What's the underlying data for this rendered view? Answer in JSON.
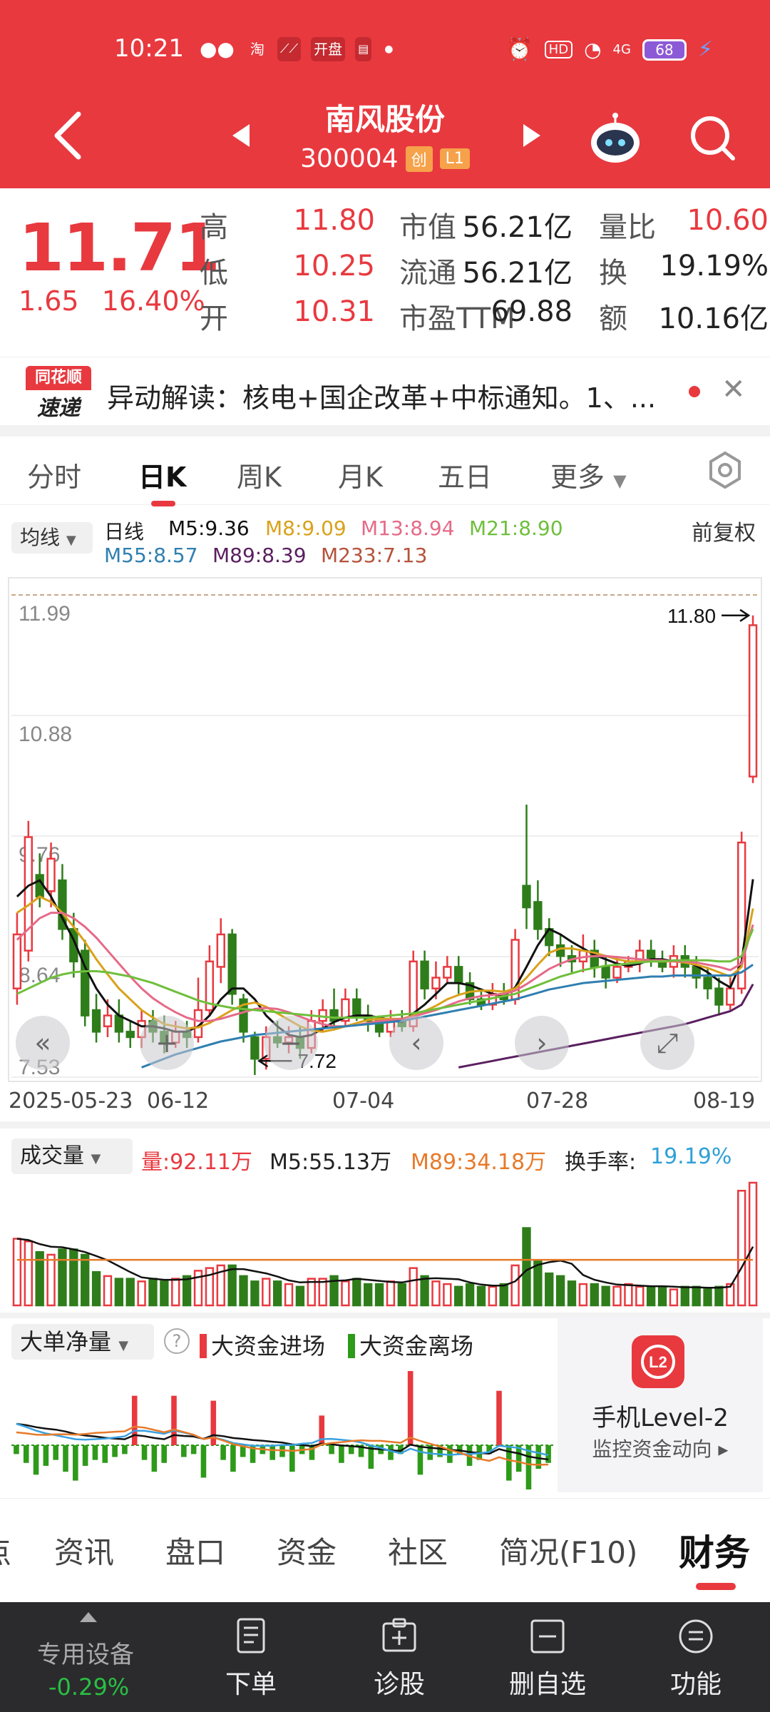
{
  "status": {
    "time": "10:21",
    "apps": [
      "淘",
      "开盘"
    ],
    "network": "HD",
    "signal": "4G",
    "battery": "68"
  },
  "header": {
    "name": "南风股份",
    "code": "300004",
    "tags": [
      "创",
      "L1"
    ]
  },
  "quote": {
    "price": "11.71",
    "change": "1.65",
    "change_pct": "16.40%",
    "rows": [
      {
        "k1": "高",
        "v1": "11.80",
        "k2": "市值",
        "v2": "56.21亿",
        "k3": "量比",
        "v3": "10.60"
      },
      {
        "k1": "低",
        "v1": "10.25",
        "k2": "流通",
        "v2": "56.21亿",
        "k3": "换",
        "v3": "19.19%"
      },
      {
        "k1": "开",
        "v1": "10.31",
        "k2": "市盈TTM",
        "v2": "69.88",
        "k3": "额",
        "v3": "10.16亿"
      }
    ]
  },
  "news": {
    "logo_top": "同花顺",
    "logo_bottom": "速递",
    "text": "异动解读：核电+国企改革+中标通知。1、..."
  },
  "period_tabs": [
    "分时",
    "日K",
    "周K",
    "月K",
    "五日",
    "更多"
  ],
  "ma_legend": {
    "chip": "均线",
    "type": "日线",
    "items": [
      {
        "label": "M5:9.36",
        "color": "#111111"
      },
      {
        "label": "M8:9.09",
        "color": "#d9a21b"
      },
      {
        "label": "M13:8.94",
        "color": "#e56a88"
      },
      {
        "label": "M21:8.90",
        "color": "#6fbf3c"
      },
      {
        "label": "M55:8.57",
        "color": "#2f7fb0"
      },
      {
        "label": "M89:8.39",
        "color": "#5a1f5f"
      },
      {
        "label": "M233:7.13",
        "color": "#b5523a"
      }
    ],
    "adjust": "前复权"
  },
  "chart_data": [
    {
      "type": "candlestick",
      "y_labels": [
        "11.99",
        "10.88",
        "9.76",
        "8.64",
        "7.53"
      ],
      "ylim": [
        7.53,
        11.99
      ],
      "high_mark": "11.80",
      "low_mark": "7.72",
      "x_labels": [
        "2025-05-23",
        "06-12",
        "07-04",
        "07-28",
        "08-19"
      ],
      "candles": [
        [
          8.35,
          8.85,
          8.2,
          9.05
        ],
        [
          8.7,
          9.75,
          8.6,
          9.9
        ],
        [
          9.4,
          9.2,
          9.1,
          9.6
        ],
        [
          9.25,
          9.55,
          9.1,
          9.7
        ],
        [
          9.35,
          8.9,
          8.8,
          9.5
        ],
        [
          8.9,
          8.6,
          8.45,
          9.05
        ],
        [
          8.7,
          8.1,
          8.0,
          8.8
        ],
        [
          8.15,
          7.95,
          7.85,
          8.3
        ],
        [
          8.0,
          8.1,
          7.9,
          8.25
        ],
        [
          8.1,
          7.95,
          7.85,
          8.25
        ],
        [
          7.95,
          7.9,
          7.8,
          8.05
        ],
        [
          7.9,
          8.05,
          7.8,
          8.15
        ],
        [
          8.05,
          7.95,
          7.85,
          8.15
        ],
        [
          7.95,
          7.85,
          7.75,
          8.1
        ],
        [
          7.85,
          7.95,
          7.8,
          8.05
        ],
        [
          7.95,
          7.9,
          7.8,
          8.05
        ],
        [
          7.9,
          8.15,
          7.85,
          8.45
        ],
        [
          8.15,
          8.6,
          8.1,
          8.75
        ],
        [
          8.55,
          8.85,
          8.4,
          9.0
        ],
        [
          8.85,
          8.3,
          8.2,
          8.9
        ],
        [
          8.25,
          7.95,
          7.85,
          8.3
        ],
        [
          7.9,
          7.7,
          7.55,
          7.95
        ],
        [
          7.7,
          7.9,
          7.6,
          8.0
        ],
        [
          7.9,
          7.85,
          7.8,
          8.05
        ],
        [
          7.85,
          7.9,
          7.75,
          8.0
        ],
        [
          7.9,
          7.8,
          7.7,
          8.0
        ],
        [
          7.8,
          8.05,
          7.75,
          8.15
        ],
        [
          8.05,
          8.15,
          7.95,
          8.25
        ],
        [
          8.15,
          8.05,
          8.0,
          8.35
        ],
        [
          8.05,
          8.25,
          8.0,
          8.35
        ],
        [
          8.25,
          8.1,
          8.05,
          8.35
        ],
        [
          8.1,
          8.05,
          7.95,
          8.2
        ],
        [
          8.05,
          7.95,
          7.9,
          8.1
        ],
        [
          7.95,
          8.05,
          7.9,
          8.15
        ],
        [
          8.05,
          8.0,
          7.95,
          8.15
        ],
        [
          8.0,
          8.6,
          7.95,
          8.7
        ],
        [
          8.6,
          8.35,
          8.25,
          8.7
        ],
        [
          8.35,
          8.45,
          8.25,
          8.6
        ],
        [
          8.45,
          8.55,
          8.4,
          8.65
        ],
        [
          8.55,
          8.4,
          8.3,
          8.65
        ],
        [
          8.4,
          8.25,
          8.2,
          8.5
        ],
        [
          8.25,
          8.2,
          8.15,
          8.35
        ],
        [
          8.2,
          8.3,
          8.15,
          8.4
        ],
        [
          8.3,
          8.25,
          8.2,
          8.4
        ],
        [
          8.25,
          8.8,
          8.2,
          8.9
        ],
        [
          9.3,
          9.1,
          8.9,
          10.05
        ],
        [
          9.15,
          8.9,
          8.8,
          9.35
        ],
        [
          8.9,
          8.75,
          8.65,
          9.0
        ],
        [
          8.75,
          8.65,
          8.55,
          8.85
        ],
        [
          8.65,
          8.6,
          8.5,
          8.75
        ],
        [
          8.6,
          8.7,
          8.5,
          8.85
        ],
        [
          8.7,
          8.55,
          8.45,
          8.8
        ],
        [
          8.55,
          8.45,
          8.35,
          8.65
        ],
        [
          8.45,
          8.55,
          8.4,
          8.65
        ],
        [
          8.55,
          8.6,
          8.5,
          8.65
        ],
        [
          8.6,
          8.7,
          8.5,
          8.8
        ],
        [
          8.7,
          8.6,
          8.55,
          8.8
        ],
        [
          8.6,
          8.55,
          8.5,
          8.7
        ],
        [
          8.55,
          8.65,
          8.45,
          8.75
        ],
        [
          8.65,
          8.55,
          8.45,
          8.75
        ],
        [
          8.55,
          8.45,
          8.35,
          8.65
        ],
        [
          8.45,
          8.35,
          8.25,
          8.55
        ],
        [
          8.35,
          8.2,
          8.1,
          8.45
        ],
        [
          8.2,
          8.35,
          8.15,
          8.45
        ],
        [
          8.35,
          9.7,
          8.3,
          9.8
        ],
        [
          10.31,
          11.71,
          10.25,
          11.8
        ]
      ],
      "ma": {
        "M5": [
          9.2,
          9.3,
          9.35,
          9.2,
          9.0,
          8.8,
          8.55,
          8.35,
          8.2,
          8.1,
          8.05,
          8.0,
          8.0,
          7.98,
          7.95,
          7.95,
          8.0,
          8.1,
          8.25,
          8.35,
          8.35,
          8.25,
          8.1,
          8.0,
          7.92,
          7.9,
          7.92,
          7.98,
          8.04,
          8.08,
          8.1,
          8.1,
          8.08,
          8.06,
          8.04,
          8.12,
          8.2,
          8.3,
          8.4,
          8.4,
          8.38,
          8.34,
          8.3,
          8.28,
          8.36,
          8.55,
          8.75,
          8.9,
          8.85,
          8.78,
          8.72,
          8.66,
          8.62,
          8.58,
          8.56,
          8.58,
          8.62,
          8.62,
          8.6,
          8.6,
          8.56,
          8.5,
          8.42,
          8.36,
          8.6,
          9.36
        ],
        "M8": [
          9.05,
          9.12,
          9.2,
          9.15,
          9.05,
          8.92,
          8.78,
          8.62,
          8.48,
          8.35,
          8.25,
          8.15,
          8.08,
          8.02,
          8.0,
          7.98,
          7.99,
          8.03,
          8.09,
          8.15,
          8.2,
          8.22,
          8.18,
          8.12,
          8.06,
          8.0,
          7.96,
          7.95,
          7.97,
          8.0,
          8.03,
          8.06,
          8.07,
          8.07,
          8.07,
          8.1,
          8.14,
          8.19,
          8.25,
          8.29,
          8.32,
          8.33,
          8.33,
          8.32,
          8.35,
          8.45,
          8.57,
          8.68,
          8.72,
          8.72,
          8.7,
          8.68,
          8.65,
          8.62,
          8.6,
          8.6,
          8.6,
          8.6,
          8.6,
          8.59,
          8.57,
          8.54,
          8.5,
          8.46,
          8.55,
          9.09
        ],
        "M13": [
          8.8,
          8.9,
          9.0,
          9.05,
          9.05,
          9.0,
          8.92,
          8.82,
          8.7,
          8.58,
          8.46,
          8.35,
          8.26,
          8.19,
          8.13,
          8.08,
          8.05,
          8.05,
          8.07,
          8.1,
          8.13,
          8.16,
          8.17,
          8.16,
          8.13,
          8.09,
          8.05,
          8.02,
          8.0,
          8.0,
          8.01,
          8.03,
          8.05,
          8.06,
          8.07,
          8.09,
          8.12,
          8.15,
          8.19,
          8.23,
          8.26,
          8.28,
          8.29,
          8.3,
          8.33,
          8.39,
          8.46,
          8.53,
          8.58,
          8.62,
          8.64,
          8.65,
          8.65,
          8.64,
          8.63,
          8.62,
          8.61,
          8.61,
          8.6,
          8.6,
          8.59,
          8.57,
          8.55,
          8.52,
          8.58,
          8.94
        ],
        "M21": [
          8.3,
          8.35,
          8.4,
          8.45,
          8.48,
          8.5,
          8.51,
          8.51,
          8.5,
          8.48,
          8.46,
          8.43,
          8.4,
          8.36,
          8.32,
          8.28,
          8.24,
          8.21,
          8.19,
          8.17,
          8.16,
          8.15,
          8.14,
          8.13,
          8.12,
          8.11,
          8.1,
          8.09,
          8.08,
          8.08,
          8.08,
          8.08,
          8.09,
          8.1,
          8.11,
          8.12,
          8.14,
          8.16,
          8.18,
          8.2,
          8.22,
          8.24,
          8.26,
          8.28,
          8.3,
          8.34,
          8.38,
          8.42,
          8.46,
          8.49,
          8.52,
          8.54,
          8.56,
          8.57,
          8.58,
          8.59,
          8.6,
          8.6,
          8.61,
          8.61,
          8.61,
          8.61,
          8.6,
          8.6,
          8.65,
          8.9
        ],
        "M55": [
          null,
          null,
          null,
          null,
          null,
          null,
          null,
          null,
          null,
          null,
          null,
          7.62,
          7.66,
          7.7,
          7.74,
          7.77,
          7.8,
          7.83,
          7.86,
          7.88,
          7.9,
          7.92,
          7.93,
          7.94,
          7.95,
          7.96,
          7.97,
          7.98,
          7.99,
          8.0,
          8.01,
          8.02,
          8.03,
          8.04,
          8.05,
          8.07,
          8.09,
          8.11,
          8.13,
          8.15,
          8.17,
          8.19,
          8.21,
          8.23,
          8.25,
          8.28,
          8.31,
          8.34,
          8.36,
          8.38,
          8.4,
          8.41,
          8.42,
          8.43,
          8.44,
          8.45,
          8.46,
          8.46,
          8.47,
          8.47,
          8.47,
          8.47,
          8.47,
          8.47,
          8.5,
          8.57
        ],
        "M89": [
          null,
          null,
          null,
          null,
          null,
          null,
          null,
          null,
          null,
          null,
          null,
          null,
          null,
          null,
          null,
          null,
          null,
          null,
          null,
          null,
          null,
          null,
          null,
          null,
          null,
          null,
          null,
          null,
          null,
          null,
          null,
          null,
          null,
          null,
          null,
          null,
          null,
          null,
          null,
          7.62,
          7.64,
          7.66,
          7.68,
          7.7,
          7.72,
          7.74,
          7.76,
          7.78,
          7.8,
          7.82,
          7.84,
          7.86,
          7.88,
          7.9,
          7.92,
          7.94,
          7.96,
          7.98,
          8.0,
          8.02,
          8.05,
          8.08,
          8.11,
          8.14,
          8.2,
          8.39
        ]
      }
    },
    {
      "type": "bar",
      "title": "成交量",
      "labels": {
        "vol": "量:92.11万",
        "m5": "M5:55.13万",
        "m89": "M89:34.18万",
        "turn_label": "换手率:",
        "turn_value": "19.19%"
      },
      "values": [
        50,
        48,
        40,
        38,
        42,
        42,
        38,
        25,
        22,
        20,
        20,
        18,
        20,
        18,
        20,
        22,
        26,
        28,
        30,
        30,
        22,
        18,
        20,
        18,
        16,
        14,
        20,
        20,
        22,
        18,
        20,
        16,
        16,
        18,
        16,
        28,
        22,
        18,
        16,
        14,
        16,
        14,
        14,
        16,
        30,
        58,
        34,
        24,
        22,
        18,
        16,
        16,
        14,
        14,
        16,
        14,
        14,
        14,
        12,
        14,
        14,
        12,
        14,
        16,
        86,
        92
      ],
      "up": [
        1,
        1,
        0,
        1,
        0,
        0,
        0,
        0,
        1,
        0,
        0,
        1,
        0,
        0,
        1,
        0,
        1,
        1,
        1,
        0,
        0,
        0,
        1,
        0,
        1,
        0,
        1,
        1,
        0,
        1,
        0,
        0,
        0,
        1,
        0,
        1,
        0,
        1,
        1,
        0,
        0,
        0,
        1,
        0,
        1,
        0,
        0,
        0,
        0,
        0,
        1,
        0,
        0,
        1,
        1,
        1,
        0,
        0,
        1,
        0,
        0,
        0,
        0,
        1,
        1,
        1
      ]
    },
    {
      "type": "bar",
      "title": "大单净量",
      "legend": [
        "大资金进场",
        "大资金离场"
      ],
      "values": [
        -3,
        -6,
        -10,
        -7,
        -5,
        -9,
        -12,
        -7,
        -5,
        -6,
        -4,
        -3,
        20,
        -5,
        -9,
        -6,
        20,
        -4,
        -3,
        -11,
        18,
        -5,
        -9,
        -4,
        -6,
        -3,
        -5,
        -4,
        -9,
        -3,
        -5,
        12,
        -3,
        -6,
        -3,
        -4,
        -8,
        -3,
        -5,
        -3,
        30,
        -10,
        -5,
        -4,
        -6,
        -3,
        -7,
        -5,
        -3,
        22,
        -12,
        -9,
        -15,
        -8,
        -6
      ]
    }
  ],
  "chart_controls": [
    "«",
    "+",
    "−",
    "‹",
    "›",
    "⤢"
  ],
  "promo": {
    "title": "手机Level-2",
    "subtitle": "监控资金动向 ▸",
    "badge": "L2"
  },
  "bottom_tabs": [
    "点",
    "资讯",
    "盘口",
    "资金",
    "社区",
    "简况(F10)",
    "财务"
  ],
  "bottom_bar": {
    "device_label": "专用设备",
    "device_value": "-0.29%",
    "actions": [
      "下单",
      "诊股",
      "删自选",
      "功能"
    ]
  },
  "colors": {
    "up": "#e8393f",
    "down": "#2e7d1a",
    "header": "#e8393f"
  }
}
